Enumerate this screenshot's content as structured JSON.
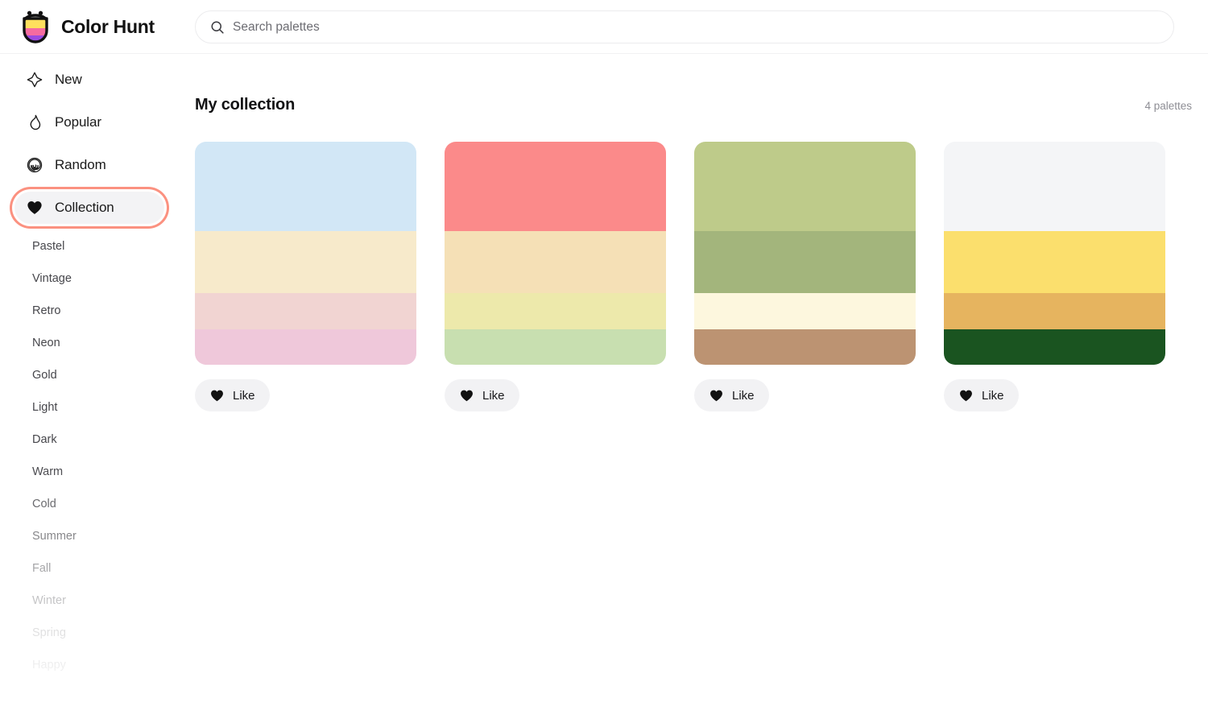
{
  "brand": {
    "name": "Color Hunt",
    "logo_icon": "colorhunt-smiley-logo",
    "logo_colors": [
      "#FFE05D",
      "#F56BA0",
      "#9B4BE0"
    ]
  },
  "search": {
    "placeholder": "Search palettes",
    "value": "",
    "icon": "search-icon"
  },
  "sidebar": {
    "nav": [
      {
        "label": "New",
        "icon": "sparkle-icon",
        "active": false
      },
      {
        "label": "Popular",
        "icon": "flame-icon",
        "active": false
      },
      {
        "label": "Random",
        "icon": "spiral-icon",
        "active": false
      },
      {
        "label": "Collection",
        "icon": "heart-icon",
        "active": true
      }
    ],
    "active_highlight_color": "#FB9180",
    "tags": [
      "Pastel",
      "Vintage",
      "Retro",
      "Neon",
      "Gold",
      "Light",
      "Dark",
      "Warm",
      "Cold",
      "Summer",
      "Fall",
      "Winter",
      "Spring",
      "Happy"
    ]
  },
  "main": {
    "title": "My collection",
    "count_label": "4 palettes",
    "like_label": "Like",
    "palettes": [
      {
        "colors": [
          "#D2E7F6",
          "#F7EACB",
          "#F1D4D2",
          "#EFC8DA"
        ],
        "weights": [
          40,
          28,
          16,
          16
        ]
      },
      {
        "colors": [
          "#FB8A8A",
          "#F5E0B6",
          "#EDE9AB",
          "#C8DFB0"
        ],
        "weights": [
          40,
          28,
          16,
          16
        ]
      },
      {
        "colors": [
          "#BECB8A",
          "#A3B57C",
          "#FDF7DE",
          "#BC9372"
        ],
        "weights": [
          40,
          28,
          16,
          16
        ]
      },
      {
        "colors": [
          "#F4F5F7",
          "#FBDF6D",
          "#E6B45F",
          "#1A5420"
        ],
        "weights": [
          40,
          28,
          16,
          16
        ]
      }
    ]
  }
}
